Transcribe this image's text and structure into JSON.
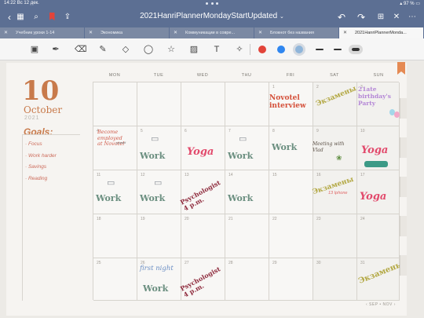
{
  "status": {
    "time": "14:22",
    "date": "Вс 12 дек.",
    "battery": "97 %"
  },
  "titlebar": {
    "title": "2021HanriPlannerMondayStartUpdated",
    "title_chevron": "⌄"
  },
  "tabs": [
    {
      "label": "Учебник уроки 1-14"
    },
    {
      "label": "Экономика"
    },
    {
      "label": "Коммуникации в совре..."
    },
    {
      "label": "Блокнот без названия"
    },
    {
      "label": "2021HanriPlannerMonda..."
    }
  ],
  "calendar": {
    "big_day": "10",
    "month": "October",
    "year": "2021",
    "goals_title": "Goals:",
    "goals": [
      "· Focus",
      "· Work harder",
      "· Savings",
      "· Reading"
    ],
    "weekdays": [
      "MON",
      "TUE",
      "WED",
      "THU",
      "FRI",
      "SAT",
      "SUN"
    ],
    "days": [
      [
        "",
        "",
        "",
        "",
        "1",
        "2",
        "3"
      ],
      [
        "4",
        "5",
        "6",
        "7",
        "8",
        "9",
        "10"
      ],
      [
        "11",
        "12",
        "13",
        "14",
        "15",
        "16",
        "17"
      ],
      [
        "18",
        "19",
        "20",
        "21",
        "22",
        "23",
        "24"
      ],
      [
        "25",
        "26",
        "27",
        "28",
        "29",
        "30",
        "31"
      ]
    ],
    "footer": "‹ SEP • NOV ›"
  },
  "notes": {
    "novotel": "Novotel interview",
    "exams": "Экзамены",
    "birthday": "21ate birthday's Party",
    "employed": "Become employed at Novotel",
    "yourself": "yourself",
    "meeting": "Meeting with Vlad",
    "work": "Work",
    "yoga": "Yoga",
    "psych": "Psychologist 4 p.m.",
    "exam2": "Экзамены",
    "exam2_sub": "13 Iphone",
    "first_night": "first night",
    "exams_last": "Экзамены"
  },
  "colors": {
    "accent": "#c87a4b",
    "red": "#e2443a",
    "blue": "#2f86f0",
    "lightblue": "#8fb5da"
  }
}
